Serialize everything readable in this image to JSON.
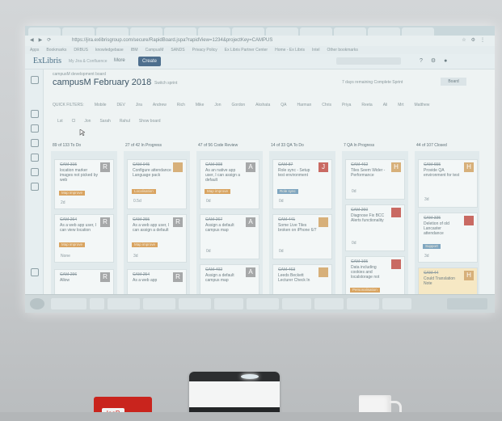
{
  "app": {
    "logo": "ExLibris",
    "logo_sub": "My Jira & Confluence",
    "more": "More",
    "create": "Create",
    "url": "https://jira.exlibrisgroup.com/secure/RapidBoard.jspa?rapidView=1234&projectKey=CAMPUS"
  },
  "bookmarks": [
    "Apps",
    "Bookmarks",
    "DRBUS",
    "knowledgebase",
    "IBM",
    "CampusM",
    "SANDS",
    "Privacy Policy",
    "Ex Libris Partner Center",
    "Home - Ex Libris",
    "Intel",
    "Other bookmarks"
  ],
  "board": {
    "project": "campusM development board",
    "title": "campusM February 2018",
    "switch": "Switch sprint",
    "remaining": "7 days remaining  Complete Sprint",
    "board_btn": "Board"
  },
  "filters": [
    "QUICK FILTERS:",
    "Mobile",
    "DEV",
    "Jira",
    "Andrew",
    "Rich",
    "Mike",
    "Jon",
    "Gordon",
    "Akshata",
    "QA",
    "Harman",
    "Chris",
    "Priya",
    "Reeta",
    "Ali",
    "Mrt",
    "Matthew"
  ],
  "quick": [
    "Lst",
    "Cl",
    "Jon",
    "Sarah",
    "Rahul",
    "Show board"
  ],
  "columns": [
    {
      "header": "89 of 133  To Do"
    },
    {
      "header": "27 of 42  In Progress"
    },
    {
      "header": "47 of 56  Code Review"
    },
    {
      "header": "14 of 33  QA To Do"
    },
    {
      "header": "7  QA In Progress"
    },
    {
      "header": "44 of 107  Closed"
    }
  ],
  "cards": [
    {
      "key": "CAM-315",
      "summary": "location marker images not picked by web",
      "label": "Map improve",
      "est": "2d",
      "avatar": "R"
    },
    {
      "key": "CAM-264",
      "summary": "As a web app user, I can view location",
      "label": "Map improve",
      "est": "None",
      "avatar": "R"
    },
    {
      "key": "CAM-296",
      "summary": "Allow",
      "label": "",
      "est": "",
      "avatar": "R"
    },
    {
      "key": "CAM-045",
      "summary": "Configure attendance Language pack",
      "label": "Localisation",
      "est": "0.5d",
      "avatar": "photo"
    },
    {
      "key": "CAM-255",
      "summary": "As a web app user, I can assign a default",
      "label": "Map improve",
      "est": "3d",
      "avatar": "R"
    },
    {
      "key": "CAM-254",
      "summary": "As a web app",
      "label": "",
      "est": "",
      "avatar": "R"
    },
    {
      "key": "CAM-008",
      "summary": "As an native app user, I can assign a default",
      "label": "Map improve",
      "est": "0d",
      "avatar": "A"
    },
    {
      "key": "CAM-267",
      "summary": "Assign a default campus map",
      "label": "",
      "est": "0d",
      "avatar": "A"
    },
    {
      "key": "CAM-402",
      "summary": "Assign a default campus map",
      "label": "",
      "est": "",
      "avatar": "A"
    },
    {
      "key": "CAM-87",
      "summary": "Role sync - Setup test environment",
      "label": "Role sync",
      "est": "0d",
      "avatar": "J"
    },
    {
      "key": "CAM-441",
      "summary": "Some Live Tiles broken on iPhone 6/7",
      "label": "",
      "est": "0d",
      "avatar": "photo"
    },
    {
      "key": "CAM-463",
      "summary": "Leeds Beckett Lecturer Check In",
      "label": "",
      "est": "",
      "avatar": "photo"
    },
    {
      "key": "CAM-462",
      "summary": "Tiles Seem Wider - Performance",
      "label": "",
      "est": "0d",
      "avatar": "H"
    },
    {
      "key": "CAM-260",
      "summary": "Diagnose Fix BCC Alerts functionality",
      "label": "",
      "est": "0d",
      "avatar": "photo"
    },
    {
      "key": "CAM-165",
      "summary": "Data including cookies and localstorage not",
      "label": "Personalisation",
      "est": "",
      "avatar": "photo"
    },
    {
      "key": "CAM-655",
      "summary": "Provide QA environment for test",
      "label": "",
      "est": "3d",
      "avatar": "H"
    },
    {
      "key": "CAM-335",
      "summary": "Deletion of old Lancaster attendance",
      "label": "Support",
      "est": "3d",
      "avatar": "photo"
    },
    {
      "key": "CAM-44",
      "summary": "Could Translation Note",
      "label": "",
      "est": "",
      "avatar": "H"
    }
  ],
  "colors": {
    "label_orange": "#d9a461",
    "label_blue": "#7fa6c0",
    "avatar_grey": "#a6a8a9",
    "avatar_red": "#c96a63",
    "avatar_tan": "#d7b07a"
  },
  "room": {
    "box_label": "IaaP"
  }
}
